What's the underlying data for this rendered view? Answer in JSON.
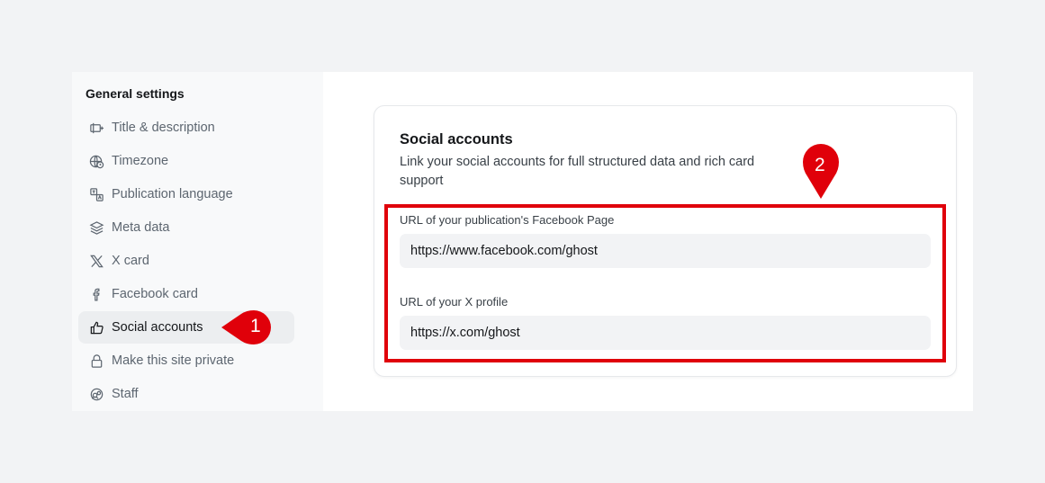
{
  "sidebar": {
    "heading": "General settings",
    "items": [
      {
        "label": "Title & description",
        "icon": "title-icon",
        "active": false
      },
      {
        "label": "Timezone",
        "icon": "globe-clock-icon",
        "active": false
      },
      {
        "label": "Publication language",
        "icon": "language-icon",
        "active": false
      },
      {
        "label": "Meta data",
        "icon": "layers-icon",
        "active": false
      },
      {
        "label": "X card",
        "icon": "x-logo-icon",
        "active": false
      },
      {
        "label": "Facebook card",
        "icon": "facebook-icon",
        "active": false
      },
      {
        "label": "Social accounts",
        "icon": "thumbs-up-icon",
        "active": true
      },
      {
        "label": "Make this site private",
        "icon": "lock-icon",
        "active": false
      },
      {
        "label": "Staff",
        "icon": "staff-icon",
        "active": false
      }
    ]
  },
  "card": {
    "title": "Social accounts",
    "description": "Link your social accounts for full structured data and rich card support",
    "facebook": {
      "label": "URL of your publication's Facebook Page",
      "value": "https://www.facebook.com/ghost"
    },
    "x_profile": {
      "label": "URL of your X profile",
      "value": "https://x.com/ghost"
    }
  },
  "annotations": {
    "callout_1": "1",
    "callout_2": "2",
    "color": "#e0000a"
  }
}
